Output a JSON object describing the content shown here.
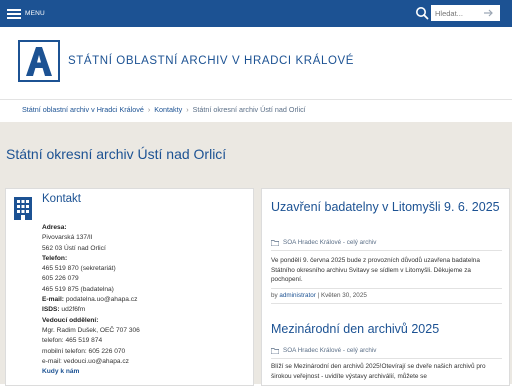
{
  "topbar": {
    "menu_label": "MENU",
    "search_placeholder": "Hledat..."
  },
  "header": {
    "site_title": "STÁTNÍ OBLASTNÍ ARCHIV V HRADCI KRÁLOVÉ",
    "logo_letter": "A"
  },
  "breadcrumb": {
    "items": [
      "Státní oblastní archiv v Hradci Králové",
      "Kontakty",
      "Státní okresní archiv Ústí nad Orlicí"
    ],
    "separator": "›"
  },
  "page": {
    "title": "Státní okresní archiv Ústí nad Orlicí"
  },
  "kontakt": {
    "title": "Kontakt",
    "lines": [
      {
        "label": "Adresa:",
        "text": ""
      },
      {
        "label": "",
        "text": "Pivovarská 137/II"
      },
      {
        "label": "",
        "text": "562 03 Ústí nad Orlicí"
      },
      {
        "label": "Telefon:",
        "text": ""
      },
      {
        "label": "",
        "text": "465 519 870 (sekretariát)"
      },
      {
        "label": "",
        "text": "605 226 079"
      },
      {
        "label": "",
        "text": "465 519 875 (badatelna)"
      },
      {
        "label": "E-mail:",
        "text": " podatelna.uo@ahapa.cz"
      },
      {
        "label": "ISDS:",
        "text": " ud2f6fm"
      },
      {
        "label": "Vedoucí oddělení:",
        "text": ""
      },
      {
        "label": "",
        "text": "Mgr. Radim Dušek, OEČ 707 306"
      },
      {
        "label": "",
        "text": "telefon: 465 519 874"
      },
      {
        "label": "",
        "text": "mobilní telefon: 605 226 070"
      },
      {
        "label": "",
        "text": "e-mail: vedouci.uo@ahapa.cz"
      }
    ],
    "partial_link": "Kudy k nám"
  },
  "posts": [
    {
      "title": "Uzavření badatelny v Litomyšli 9. 6. 2025",
      "category": "SOA Hradec Králové - celý archiv",
      "text": "Ve pondělí 9. června 2025 bude z provozních důvodů uzavřena badatelna Státního okresního archivu Svitavy se sídlem v Litomyšli. Děkujeme za pochopení.",
      "by_label": "by",
      "author": "administrator",
      "date": "Květen 30, 2025"
    },
    {
      "title": "Mezinárodní den archivů 2025",
      "category": "SOA Hradec Králové - celý archiv",
      "text": "Blíží se Mezinárodní den archivů 2025!Otevírají se dveře našich archivů pro širokou veřejnost - uvidíte výstavy archiválií, můžete se"
    }
  ],
  "colors": {
    "brand_blue": "#1c5293",
    "band_bg": "#ebe8e2"
  }
}
